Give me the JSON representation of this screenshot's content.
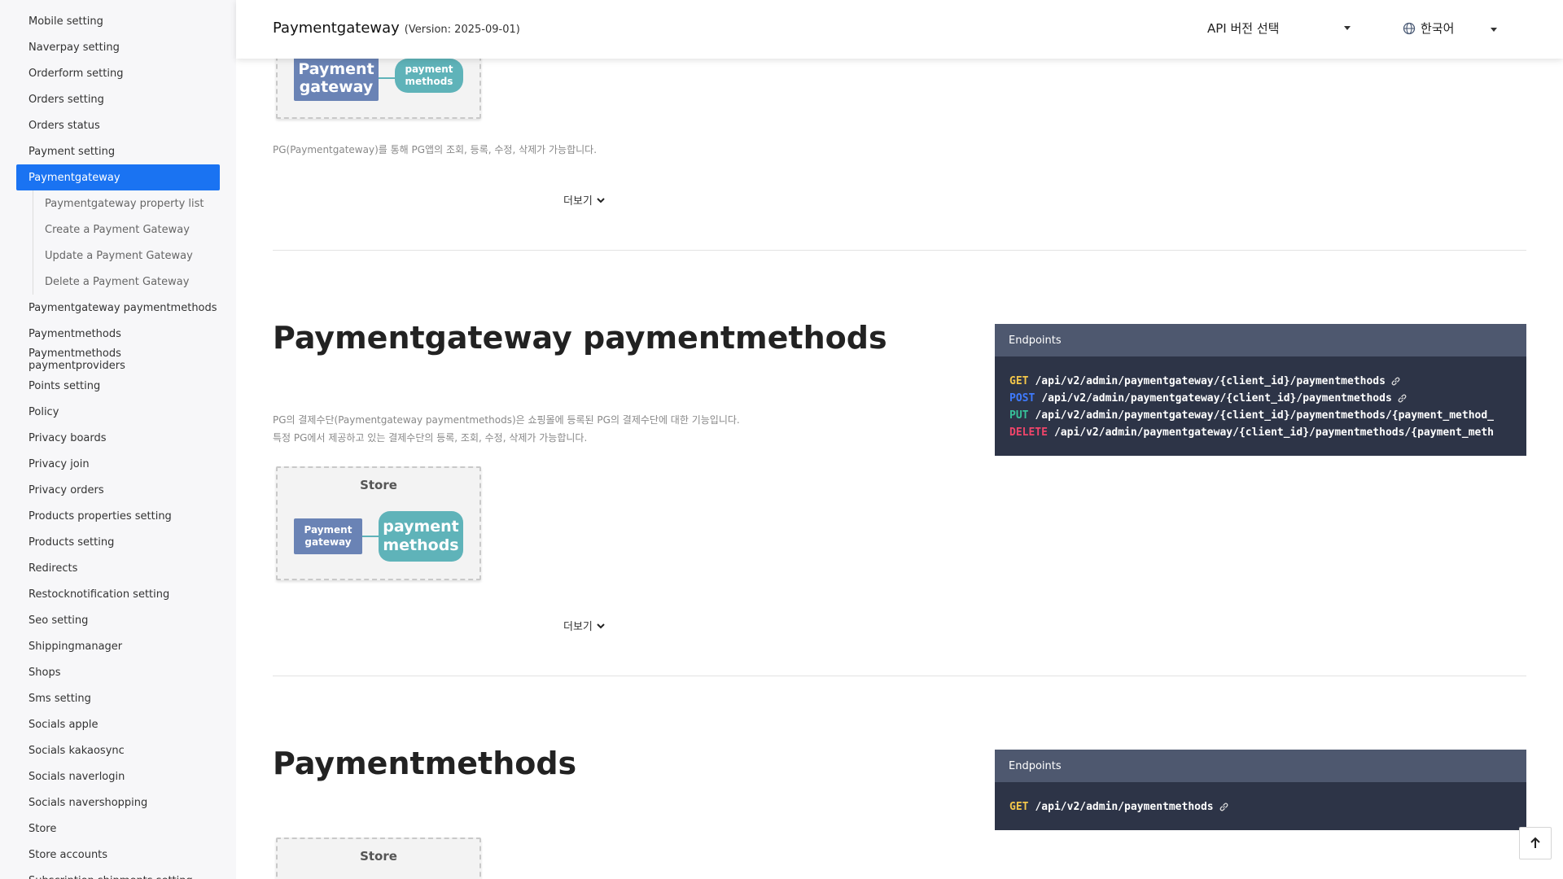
{
  "sidebar": {
    "items_before": [
      "Mobile setting",
      "Naverpay setting",
      "Orderform setting",
      "Orders setting",
      "Orders status",
      "Payment setting"
    ],
    "active": "Paymentgateway",
    "sub_items": [
      "Paymentgateway property list",
      "Create a Payment Gateway",
      "Update a Payment Gateway",
      "Delete a Payment Gateway"
    ],
    "items_after": [
      "Paymentgateway paymentmethods",
      "Paymentmethods",
      "Paymentmethods paymentproviders",
      "Points setting",
      "Policy",
      "Privacy boards",
      "Privacy join",
      "Privacy orders",
      "Products properties setting",
      "Products setting",
      "Redirects",
      "Restocknotification setting",
      "Seo setting",
      "Shippingmanager",
      "Shops",
      "Sms setting",
      "Socials apple",
      "Socials kakaosync",
      "Socials naverlogin",
      "Socials navershopping",
      "Store",
      "Store accounts",
      "Subscription shipments setting"
    ]
  },
  "header": {
    "title": "Paymentgateway",
    "version": "(Version: 2025-09-01)",
    "api_select": "API 버전 선택",
    "language": "한국어"
  },
  "section1": {
    "diagram": {
      "pg": "Payment gateway",
      "pm": "payment methods"
    },
    "desc": "PG(Paymentgateway)를 통해 PG앱의 조회, 등록, 수정, 삭제가 가능합니다.",
    "more": "더보기"
  },
  "section2": {
    "title": "Paymentgateway paymentmethods",
    "desc_line1": "PG의 결제수단(Paymentgateway paymentmethods)은 쇼핑몰에 등록된 PG의 결제수단에 대한 기능입니다.",
    "desc_line2": "특정 PG에서 제공하고 있는 결제수단의 등록, 조회, 수정, 삭제가 가능합니다.",
    "diagram": {
      "store": "Store",
      "pg": "Payment gateway",
      "pm": "payment methods"
    },
    "more": "더보기",
    "endpoints_title": "Endpoints",
    "endpoints": [
      {
        "method": "GET",
        "path": "/api/v2/admin/paymentgateway/{client_id}/paymentmethods"
      },
      {
        "method": "POST",
        "path": "/api/v2/admin/paymentgateway/{client_id}/paymentmethods"
      },
      {
        "method": "PUT",
        "path": "/api/v2/admin/paymentgateway/{client_id}/paymentmethods/{payment_method_"
      },
      {
        "method": "DELETE",
        "path": "/api/v2/admin/paymentgateway/{client_id}/paymentmethods/{payment_meth"
      }
    ]
  },
  "section3": {
    "title": "Paymentmethods",
    "diagram": {
      "store": "Store"
    },
    "endpoints_title": "Endpoints",
    "endpoints": [
      {
        "method": "GET",
        "path": "/api/v2/admin/paymentmethods"
      }
    ]
  }
}
